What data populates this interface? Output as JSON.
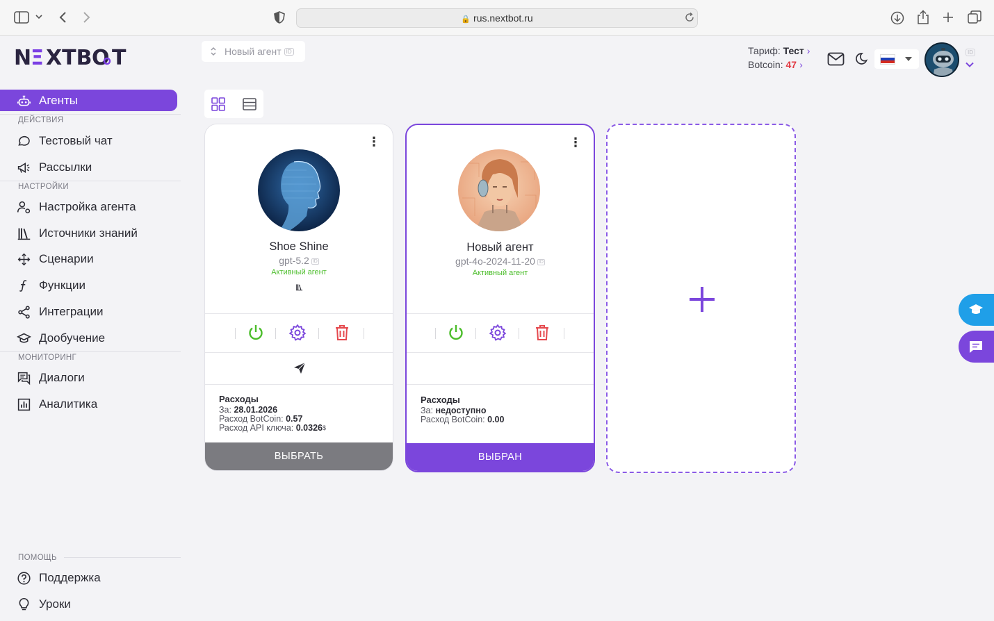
{
  "browser": {
    "url": "rus.nextbot.ru"
  },
  "brand": {
    "logo_text_left": "N",
    "logo_text_mid": "E",
    "logo_text_right": "XTB",
    "logo_o": "O",
    "logo_t": "T",
    "accent": "#7b46dc"
  },
  "sidebar": {
    "active_item": "Агенты",
    "sections": {
      "actions": "ДЕЙСТВИЯ",
      "settings": "НАСТРОЙКИ",
      "monitoring": "МОНИТОРИНГ",
      "help": "ПОМОЩЬ"
    },
    "items": {
      "test_chat": "Тестовый чат",
      "mailings": "Рассылки",
      "agent_settings": "Настройка агента",
      "knowledge": "Источники знаний",
      "scenarios": "Сценарии",
      "functions": "Функции",
      "integrations": "Интеграции",
      "training": "Дообучение",
      "dialogs": "Диалоги",
      "analytics": "Аналитика",
      "support": "Поддержка",
      "lessons": "Уроки"
    }
  },
  "topbar": {
    "agent_select": "Новый агент",
    "id_badge": "ID",
    "tariff_label": "Тариф:",
    "tariff_value": "Тест",
    "botcoin_label": "Botcoin:",
    "botcoin_value": "47"
  },
  "cards": [
    {
      "name": "Shoe Shine",
      "model": "gpt-5.2",
      "id_badge": "ID",
      "status": "Активный агент",
      "expenses_title": "Расходы",
      "period_label": "За:",
      "period_value": "28.01.2026",
      "botcoin_label": "Расход BotCoin:",
      "botcoin_value": "0.57",
      "api_label": "Расход API ключа:",
      "api_value": "0.0326",
      "api_unit": "$",
      "button": "ВЫБРАТЬ"
    },
    {
      "name": "Новый агент",
      "model": "gpt-4o-2024-11-20",
      "id_badge": "ID",
      "status": "Активный агент",
      "expenses_title": "Расходы",
      "period_label": "За:",
      "period_value": "недоступно",
      "botcoin_label": "Расход BotCoin:",
      "botcoin_value": "0.00",
      "button": "ВЫБРАН"
    }
  ]
}
